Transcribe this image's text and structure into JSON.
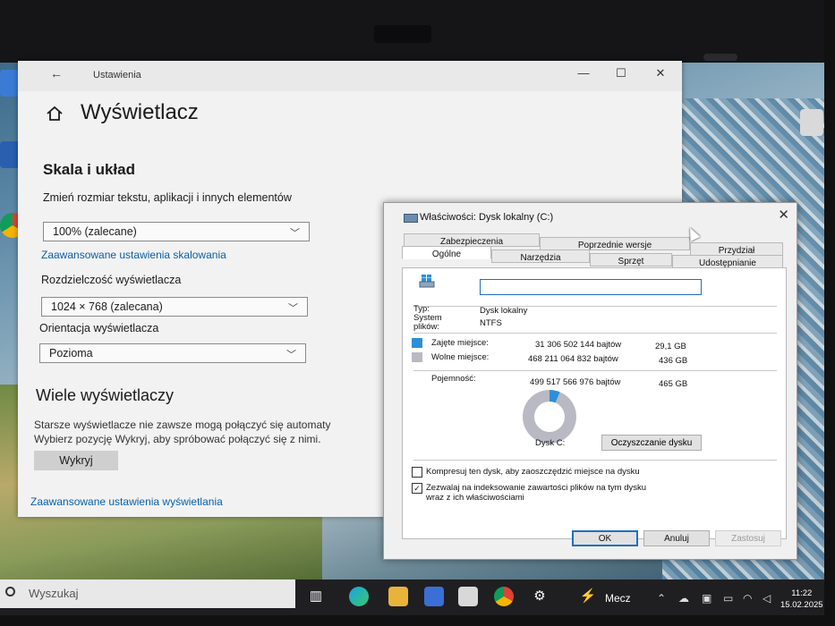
{
  "settings": {
    "app_title": "Ustawienia",
    "page_title": "Wyświetlacz",
    "section_scale": "Skala i układ",
    "text_size_label": "Zmień rozmiar tekstu, aplikacji i innych elementów",
    "text_size_value": "100% (zalecane)",
    "advanced_scaling_link": "Zaawansowane ustawienia skalowania",
    "resolution_label": "Rozdzielczość wyświetlacza",
    "resolution_value": "1024 × 768 (zalecana)",
    "orientation_label": "Orientacja wyświetlacza",
    "orientation_value": "Pozioma",
    "section_multi": "Wiele wyświetlaczy",
    "multi_desc_1": "Starsze wyświetlacze nie zawsze mogą połączyć się automaty",
    "multi_desc_2": "Wybierz pozycję Wykryj, aby spróbować połączyć się z nimi.",
    "detect_button": "Wykryj",
    "advanced_display_link": "Zaawansowane ustawienia wyświetlania"
  },
  "properties": {
    "title": "Właściwości: Dysk lokalny (C:)",
    "tabs": {
      "security": "Zabezpieczenia",
      "previous": "Poprzednie wersje",
      "quota": "Przydział",
      "general": "Ogólne",
      "tools": "Narzędzia",
      "hardware": "Sprzęt",
      "sharing": "Udostępnianie"
    },
    "name_value": "",
    "type_label": "Typ:",
    "type_value": "Dysk lokalny",
    "fs_label_1": "System",
    "fs_label_2": "plików:",
    "fs_value": "NTFS",
    "used_label": "Zajęte miejsce:",
    "used_bytes": "31 306 502 144 bajtów",
    "used_gb": "29,1 GB",
    "free_label": "Wolne miejsce:",
    "free_bytes": "468 211 064 832 bajtów",
    "free_gb": "436 GB",
    "capacity_label": "Pojemność:",
    "capacity_bytes": "499 517 566 976 bajtów",
    "capacity_gb": "465 GB",
    "disk_label": "Dysk C:",
    "cleanup_button": "Oczyszczanie dysku",
    "compress_label": "Kompresuj ten dysk, aby zaoszczędzić miejsce na dysku",
    "compress_checked": false,
    "index_label_1": "Zezwalaj na indeksowanie zawartości plików na tym dysku",
    "index_label_2": "wraz z ich właściwościami",
    "index_checked": true,
    "ok_button": "OK",
    "cancel_button": "Anuluj",
    "apply_button": "Zastosuj",
    "used_fraction": 0.063
  },
  "taskbar": {
    "search_placeholder": "Wyszukaj",
    "weather_text": "Mecz",
    "time": "11:22",
    "date": "15.02.2025"
  },
  "colors": {
    "used_color": "#2d8fd8",
    "free_color": "#b9b9c4",
    "link_color": "#0a5fa8"
  }
}
